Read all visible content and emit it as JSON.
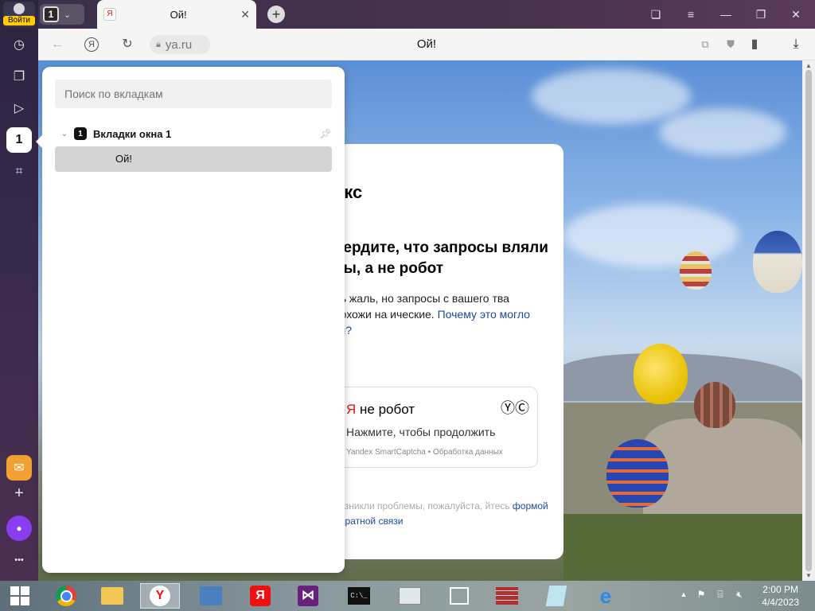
{
  "sidebar": {
    "login_label": "Войти",
    "items": [
      {
        "icon": "history-icon",
        "glyph": "◷"
      },
      {
        "icon": "collections-icon",
        "glyph": "❐"
      },
      {
        "icon": "video-icon",
        "glyph": "▷"
      },
      {
        "icon": "tabs-counter-icon",
        "glyph": "1"
      },
      {
        "icon": "screenshot-icon",
        "glyph": "⌗"
      }
    ],
    "bottom": [
      {
        "icon": "mail-icon",
        "glyph": "✉"
      },
      {
        "icon": "add-icon",
        "glyph": "+"
      },
      {
        "icon": "alice-icon",
        "glyph": "●"
      },
      {
        "icon": "more-icon",
        "glyph": "•••"
      }
    ]
  },
  "tabstrip": {
    "tab_count": "1",
    "active_tab_title": "Ой!",
    "favicon_glyph": "Я"
  },
  "toolbar": {
    "url": "ya.ru",
    "page_title": "Ой!"
  },
  "captcha": {
    "brand": "екс",
    "heading": "вердите, что запросы вляли вы, а не робот",
    "desc_text": "нь жаль, но запросы с вашего тва похожи на ические. ",
    "desc_link": "Почему это могло ти?",
    "box_ya": "Я",
    "box_title": "не робот",
    "box_sub": "Нажмите, чтобы продолжить",
    "box_foot": "Yandex SmartCaptcha • Обработка данных",
    "problems_text": "возникли проблемы, пожалуйста, йтесь ",
    "problems_link": "формой обратной связи"
  },
  "tab_panel": {
    "search_placeholder": "Поиск по вкладкам",
    "window_badge": "1",
    "window_label": "Вкладки окна 1",
    "tab_title": "Ой!"
  },
  "taskbar": {
    "time": "2:00 PM",
    "date": "4/4/2023"
  }
}
